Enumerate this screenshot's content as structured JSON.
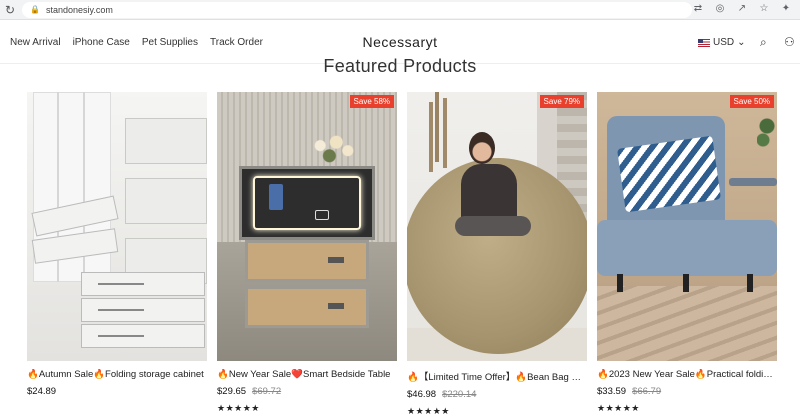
{
  "browser": {
    "url": "standonesiy.com",
    "reload_icon": "reload-icon",
    "lock_icon": "lock-icon"
  },
  "header": {
    "nav": [
      "New Arrival",
      "iPhone Case",
      "Pet Supplies",
      "Track Order"
    ],
    "brand": "Necessaryt",
    "currency": "USD",
    "currency_flag": "us-flag-icon"
  },
  "section": {
    "title": "Featured Products"
  },
  "products": [
    {
      "title": "🔥Autumn Sale🔥Folding storage cabinet",
      "price": "$24.89",
      "was": "",
      "badge": "",
      "stars": "★★★★★"
    },
    {
      "title": "🔥New Year Sale❤️Smart Bedside Table",
      "price": "$29.65",
      "was": "$69.72",
      "badge": "Save 58%",
      "stars": "★★★★★"
    },
    {
      "title": "🔥【Limited Time Offer】🔥Bean Bag Chair",
      "price": "$46.98",
      "was": "$220.14",
      "badge": "Save 79%",
      "stars": "★★★★★"
    },
    {
      "title": "🔥2023 New Year Sale🔥Practical folding sofa bed",
      "price": "$33.59",
      "was": "$66.79",
      "badge": "Save 50%",
      "stars": "★★★★★"
    }
  ],
  "colors": {
    "badge": "#e8402c",
    "text": "#222222"
  }
}
